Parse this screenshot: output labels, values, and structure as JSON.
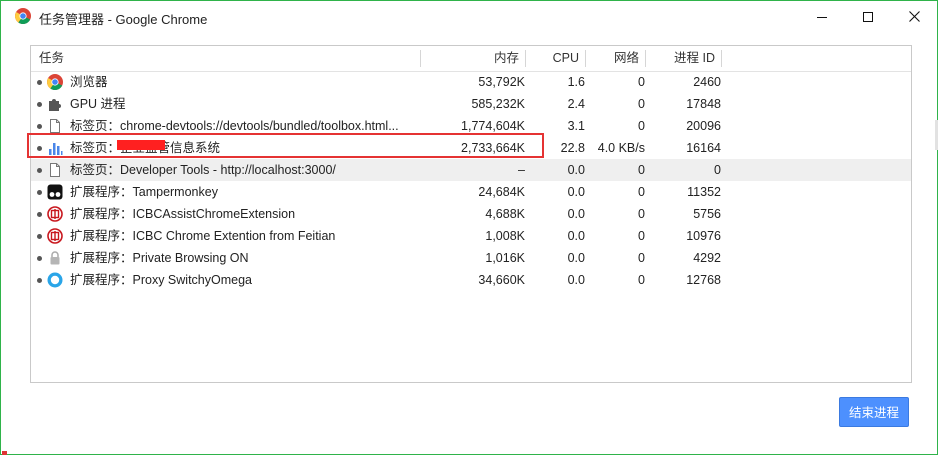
{
  "window": {
    "title": "任务管理器 - Google Chrome"
  },
  "columns": {
    "task": "任务",
    "memory": "内存",
    "cpu": "CPU",
    "network": "网络",
    "pid": "进程 ID"
  },
  "rows": [
    {
      "icon": "chrome-icon",
      "title": "浏览器",
      "memory": "53,792K",
      "cpu": "1.6",
      "network": "0",
      "pid": "2460"
    },
    {
      "icon": "puzzle-icon",
      "title": "GPU 进程",
      "memory": "585,232K",
      "cpu": "2.4",
      "network": "0",
      "pid": "17848"
    },
    {
      "icon": "page-icon",
      "title": "标签页：chrome-devtools://devtools/bundled/toolbox.html...",
      "memory": "1,774,604K",
      "cpu": "3.1",
      "network": "0",
      "pid": "20096"
    },
    {
      "icon": "bar-chart-icon",
      "title": "标签页：企业监管信息系统",
      "memory": "2,733,664K",
      "cpu": "22.8",
      "network": "4.0 KB/s",
      "pid": "16164"
    },
    {
      "icon": "page-icon",
      "title": "标签页：Developer Tools - http://localhost:3000/",
      "memory": "–",
      "cpu": "0.0",
      "network": "0",
      "pid": "0"
    },
    {
      "icon": "tampermonkey-icon",
      "title": "扩展程序：Tampermonkey",
      "memory": "24,684K",
      "cpu": "0.0",
      "network": "0",
      "pid": "11352"
    },
    {
      "icon": "icbc-icon",
      "title": "扩展程序：ICBCAssistChromeExtension",
      "memory": "4,688K",
      "cpu": "0.0",
      "network": "0",
      "pid": "5756"
    },
    {
      "icon": "icbc-icon",
      "title": "扩展程序：ICBC Chrome Extention from Feitian",
      "memory": "1,008K",
      "cpu": "0.0",
      "network": "0",
      "pid": "10976"
    },
    {
      "icon": "lock-icon",
      "title": "扩展程序：Private Browsing ON",
      "memory": "1,016K",
      "cpu": "0.0",
      "network": "0",
      "pid": "4292"
    },
    {
      "icon": "switchyomega-icon",
      "title": "扩展程序：Proxy SwitchyOmega",
      "memory": "34,660K",
      "cpu": "0.0",
      "network": "0",
      "pid": "12768"
    }
  ],
  "buttons": {
    "end_process": "结束进程"
  },
  "colors": {
    "accent": "#4d90fe",
    "highlight": "#e53333",
    "border": "#2fb34a"
  }
}
